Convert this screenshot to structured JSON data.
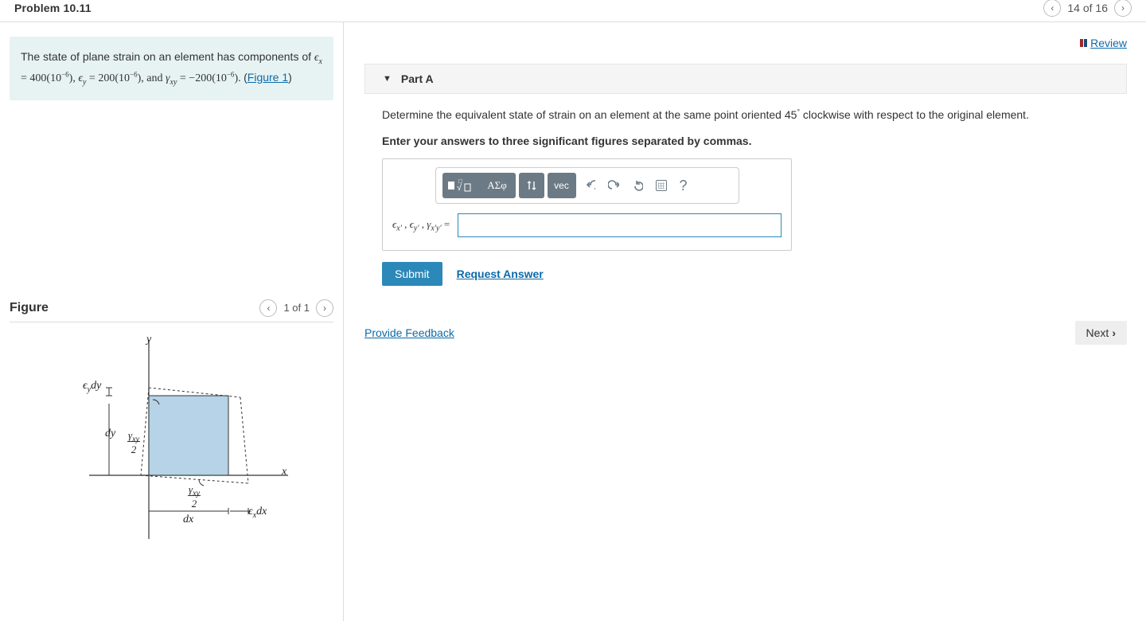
{
  "header": {
    "title": "Problem 10.11",
    "progress": "14 of 16"
  },
  "review": {
    "label": "Review"
  },
  "problem": {
    "intro": "The state of plane strain on an element has components of",
    "ex_val": "400(10",
    "ex_exp": "−6",
    "ex_close": ")",
    "ey_val": "200(10",
    "ey_exp": "−6",
    "ey_close": ")",
    "gxy_val": "−200(10",
    "gxy_exp": "−6",
    "gxy_close": ")",
    "and": ", and",
    "figure_link": "Figure 1"
  },
  "partA": {
    "title": "Part A",
    "prompt_pre": "Determine the equivalent state of strain on an element at the same point oriented 45",
    "degree": "°",
    "prompt_post": " clockwise with respect to the original element.",
    "hint": "Enter your answers to three significant figures separated by commas.",
    "greek": "ΑΣφ",
    "vec": "vec",
    "label_equals": " = ",
    "submit": "Submit",
    "request": "Request Answer"
  },
  "feedback": {
    "label": "Provide Feedback"
  },
  "next": {
    "label": "Next"
  },
  "figure": {
    "title": "Figure",
    "counter": "1 of 1",
    "labels": {
      "y": "y",
      "x": "x",
      "eydy": "ϵ_y dy",
      "dy": "dy",
      "gxy2_left": "γ_xy / 2",
      "gxy2_bot": "γ_xy / 2",
      "dx": "dx",
      "exdx": "ϵ_x dx"
    }
  }
}
